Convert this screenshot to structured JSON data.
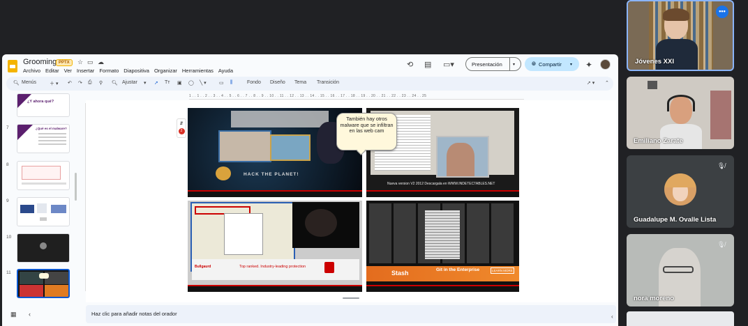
{
  "doc": {
    "title": "Grooming",
    "badge": "PPTX"
  },
  "menu": [
    "Archivo",
    "Editar",
    "Ver",
    "Insertar",
    "Formato",
    "Diapositiva",
    "Organizar",
    "Herramientas",
    "Ayuda"
  ],
  "header": {
    "present_label": "Presentación",
    "share_label": "Compartir"
  },
  "toolbar": {
    "search": "Menús",
    "zoom": "Ajustar",
    "bg": "Fondo",
    "layout": "Diseño",
    "theme": "Tema",
    "transition": "Transición"
  },
  "ruler": "1 . . 1 . . 2 . . 3 . . 4 . . 5 . . 6 . . 7 . . 8 . . 9 . . 10 . . 11 . . 12 . . 13 . . 14 . . 15 . . 16 . . 17 . . 18 . . 19 . . 20 . . 21 . . 22 . . 23 . . 24 . . 25",
  "thumbs": [
    {
      "num": "",
      "text": "¿Y ahora qué?"
    },
    {
      "num": "7",
      "text": "¿Qué es el malware?"
    },
    {
      "num": "8",
      "text": ""
    },
    {
      "num": "9",
      "text": ""
    },
    {
      "num": "10",
      "text": ""
    },
    {
      "num": "11",
      "text": ""
    }
  ],
  "slide": {
    "bubble": "También hay otros malware que se infiltran en las web cam",
    "hack_text": "HACK THE PLANET!",
    "version_text": "Nueva version V2 2012 Descargala en WWW.INDETECTABLES.NET",
    "protection_text": "Top ranked. Industry-leading protection",
    "stash_text": "Stash",
    "git_text": "Git in the Enterprise",
    "learn_more": "LEARN MORE"
  },
  "notes": {
    "placeholder": "Haz clic para añadir notas del orador"
  },
  "participants": [
    {
      "name": "Jóvenes XXI",
      "active": true
    },
    {
      "name": "Emiliano Zarate",
      "active": false
    },
    {
      "name": "Guadalupe M. Ovalle Lista",
      "active": false
    },
    {
      "name": "nora moreno",
      "active": false
    }
  ]
}
